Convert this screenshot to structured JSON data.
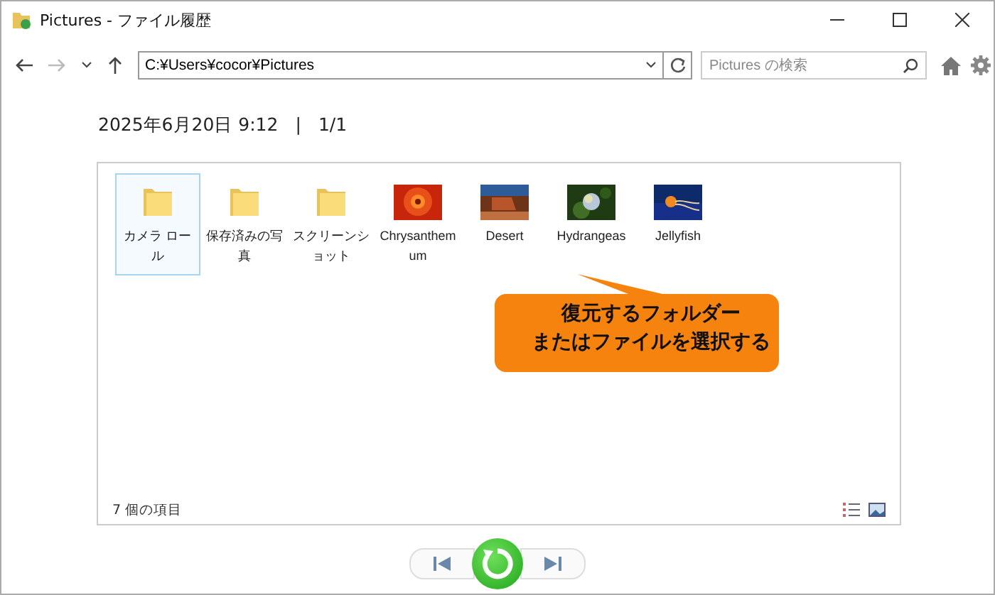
{
  "window": {
    "title": "Pictures - ファイル履歴"
  },
  "toolbar": {
    "address": "C:¥Users¥cocor¥Pictures",
    "search": {
      "placeholder": "Pictures の検索"
    }
  },
  "header": {
    "date": "2025年6月20日 9:12",
    "separator": "|",
    "page": "1/1"
  },
  "items": [
    {
      "kind": "folder",
      "label": "カメラ ロール",
      "selected": true
    },
    {
      "kind": "folder",
      "label": "保存済みの写真",
      "selected": false
    },
    {
      "kind": "folder",
      "label": "スクリーンショット",
      "selected": false
    },
    {
      "kind": "picture",
      "label": "Chrysanthemum",
      "selected": false
    },
    {
      "kind": "picture",
      "label": "Desert",
      "selected": false
    },
    {
      "kind": "picture",
      "label": "Hydrangeas",
      "selected": false
    },
    {
      "kind": "picture",
      "label": "Jellyfish",
      "selected": false
    }
  ],
  "status": "7 個の項目",
  "callout": {
    "lines": [
      "復元するフォルダー",
      "またはファイルを選択する"
    ]
  }
}
